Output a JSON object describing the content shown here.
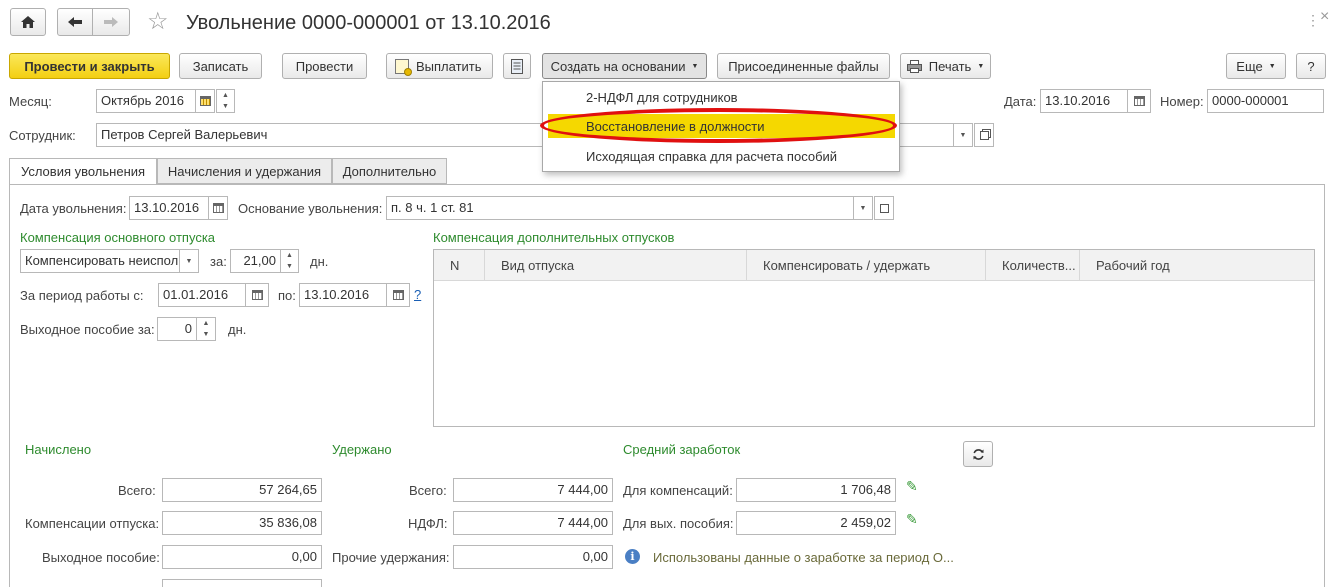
{
  "window": {
    "title": "Увольнение 0000-000001 от 13.10.2016"
  },
  "toolbar": {
    "post_close": "Провести и закрыть",
    "save": "Записать",
    "post": "Провести",
    "pay": "Выплатить",
    "create_based": "Создать на основании",
    "attached_files": "Присоединенные файлы",
    "print": "Печать",
    "more": "Еще",
    "help": "?"
  },
  "create_menu": {
    "items": [
      "2-НДФЛ для сотрудников",
      "Восстановление в должности",
      "Исходящая справка для расчета пособий"
    ],
    "highlight_color": "#f5d800",
    "annotation_color": "#e01010"
  },
  "header": {
    "month_label": "Месяц:",
    "month_value": "Октябрь 2016",
    "date_label": "Дата:",
    "date_value": "13.10.2016",
    "number_label": "Номер:",
    "number_value": "0000-000001",
    "employee_label": "Сотрудник:",
    "employee_value": "Петров Сергей Валерьевич"
  },
  "tabs": [
    "Условия увольнения",
    "Начисления и удержания",
    "Дополнительно"
  ],
  "conditions": {
    "dismissal_date_label": "Дата увольнения:",
    "dismissal_date": "13.10.2016",
    "reason_label": "Основание увольнения:",
    "reason_value": "п. 8 ч. 1 ст. 81",
    "main_comp_title": "Компенсация основного отпуска",
    "comp_mode": "Компенсировать неиспол",
    "for_label": "за:",
    "days_value": "21,00",
    "days_unit": "дн.",
    "period_label": "За период работы с:",
    "period_from": "01.01.2016",
    "period_to_label": "по:",
    "period_to": "13.10.2016",
    "period_help": "?",
    "severance_label": "Выходное пособие за:",
    "severance_days": "0",
    "severance_unit": "дн.",
    "add_comp_title": "Компенсация дополнительных отпусков",
    "add_comp_columns": [
      "N",
      "Вид отпуска",
      "Компенсировать / удержать",
      "Количеств...",
      "Рабочий год"
    ]
  },
  "accrued": {
    "title": "Начислено",
    "total_label": "Всего:",
    "total": "57 264,65",
    "vacation_label": "Компенсации отпуска:",
    "vacation": "35 836,08",
    "severance_label": "Выходное пособие:",
    "severance": "0,00"
  },
  "withheld": {
    "title": "Удержано",
    "total_label": "Всего:",
    "total": "7 444,00",
    "ndfl_label": "НДФЛ:",
    "ndfl": "7 444,00",
    "other_label": "Прочие удержания:",
    "other": "0,00"
  },
  "average": {
    "title": "Средний заработок",
    "comp_label": "Для компенсаций:",
    "comp": "1 706,48",
    "severance_label": "Для вых. пособия:",
    "severance": "2 459,02",
    "info": "Использованы данные о заработке за период О..."
  },
  "colors": {
    "accent_green": "#2e8b2e",
    "primary_yellow": "#f3cf12"
  }
}
